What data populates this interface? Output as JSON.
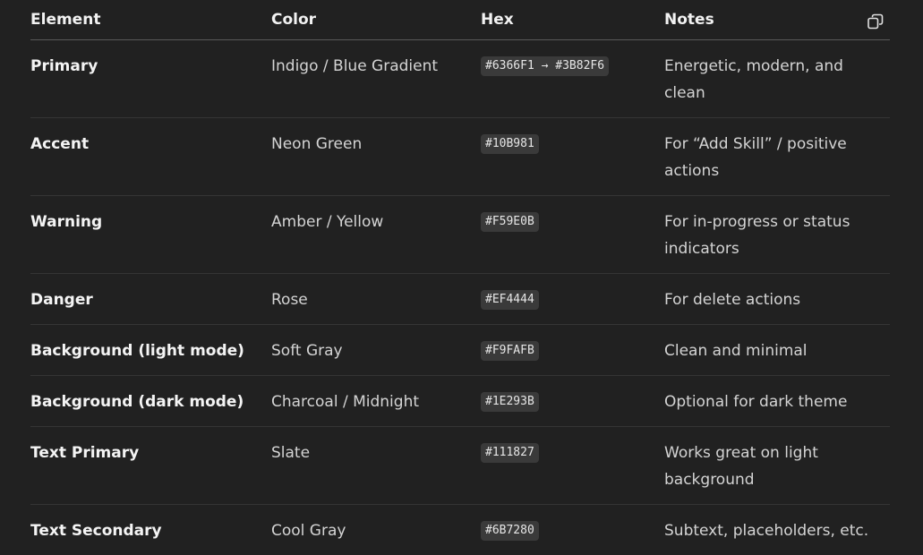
{
  "table": {
    "headers": {
      "element": "Element",
      "color": "Color",
      "hex": "Hex",
      "notes": "Notes"
    },
    "copy_icon": "copy-icon",
    "rows": [
      {
        "element": "Primary",
        "color": "Indigo / Blue Gradient",
        "hex": "#6366F1 → #3B82F6",
        "notes": "Energetic, modern, and clean"
      },
      {
        "element": "Accent",
        "color": "Neon Green",
        "hex": "#10B981",
        "notes": "For “Add Skill” / positive actions"
      },
      {
        "element": "Warning",
        "color": "Amber / Yellow",
        "hex": "#F59E0B",
        "notes": "For in-progress or status indicators"
      },
      {
        "element": "Danger",
        "color": "Rose",
        "hex": "#EF4444",
        "notes": "For delete actions"
      },
      {
        "element": "Background (light mode)",
        "color": "Soft Gray",
        "hex": "#F9FAFB",
        "notes": "Clean and minimal"
      },
      {
        "element": "Background (dark mode)",
        "color": "Charcoal / Midnight",
        "hex": "#1E293B",
        "notes": "Optional for dark theme"
      },
      {
        "element": "Text Primary",
        "color": "Slate",
        "hex": "#111827",
        "notes": "Works great on light background"
      },
      {
        "element": "Text Secondary",
        "color": "Cool Gray",
        "hex": "#6B7280",
        "notes": "Subtext, placeholders, etc."
      }
    ]
  }
}
